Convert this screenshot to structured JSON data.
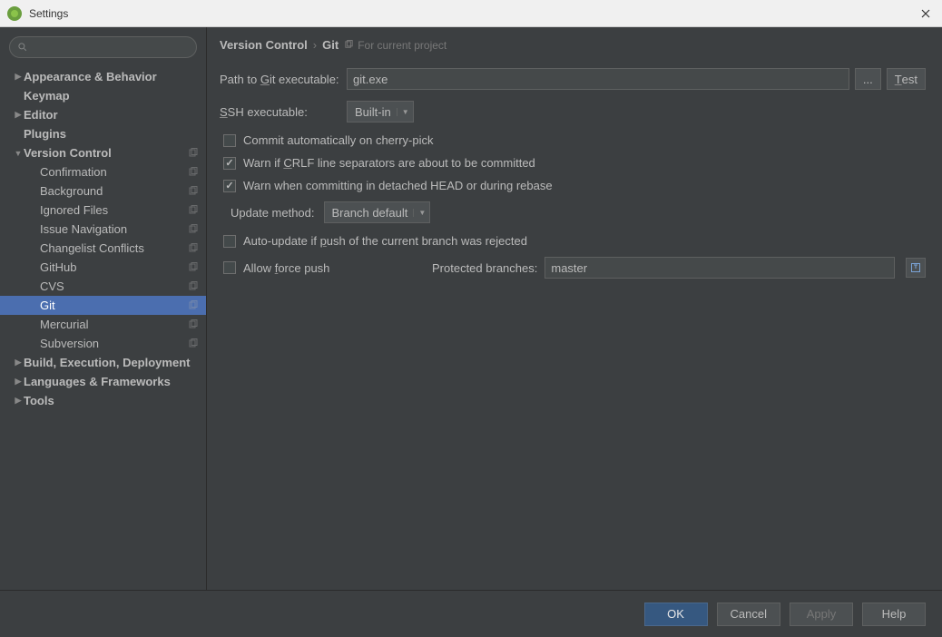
{
  "titlebar": {
    "title": "Settings"
  },
  "breadcrumb": {
    "root": "Version Control",
    "sep": "›",
    "leaf": "Git",
    "note": "For current project"
  },
  "sidebar": {
    "items": [
      {
        "label": "Appearance & Behavior",
        "level": 0,
        "arrow": "▶",
        "bold": true
      },
      {
        "label": "Keymap",
        "level": 0,
        "arrow": "",
        "bold": true
      },
      {
        "label": "Editor",
        "level": 0,
        "arrow": "▶",
        "bold": true
      },
      {
        "label": "Plugins",
        "level": 0,
        "arrow": "",
        "bold": true
      },
      {
        "label": "Version Control",
        "level": 0,
        "arrow": "▼",
        "bold": true,
        "badge": true
      },
      {
        "label": "Confirmation",
        "level": 1,
        "arrow": "",
        "badge": true
      },
      {
        "label": "Background",
        "level": 1,
        "arrow": "",
        "badge": true
      },
      {
        "label": "Ignored Files",
        "level": 1,
        "arrow": "",
        "badge": true
      },
      {
        "label": "Issue Navigation",
        "level": 1,
        "arrow": "",
        "badge": true
      },
      {
        "label": "Changelist Conflicts",
        "level": 1,
        "arrow": "",
        "badge": true
      },
      {
        "label": "GitHub",
        "level": 1,
        "arrow": "",
        "badge": true
      },
      {
        "label": "CVS",
        "level": 1,
        "arrow": "",
        "badge": true
      },
      {
        "label": "Git",
        "level": 1,
        "arrow": "",
        "badge": true,
        "selected": true
      },
      {
        "label": "Mercurial",
        "level": 1,
        "arrow": "",
        "badge": true
      },
      {
        "label": "Subversion",
        "level": 1,
        "arrow": "",
        "badge": true
      },
      {
        "label": "Build, Execution, Deployment",
        "level": 0,
        "arrow": "▶",
        "bold": true
      },
      {
        "label": "Languages & Frameworks",
        "level": 0,
        "arrow": "▶",
        "bold": true
      },
      {
        "label": "Tools",
        "level": 0,
        "arrow": "▶",
        "bold": true
      }
    ]
  },
  "form": {
    "path_label_pre": "Path to ",
    "path_label_u": "G",
    "path_label_post": "it executable:",
    "path_value": "git.exe",
    "browse": "...",
    "test_u": "T",
    "test_post": "est",
    "ssh_label_u": "S",
    "ssh_label_post": "SH executable:",
    "ssh_value": "Built-in",
    "cb_commit": "Commit automatically on cherry-pick",
    "cb_crlf_pre": "Warn if ",
    "cb_crlf_u": "C",
    "cb_crlf_post": "RLF line separators are about to be committed",
    "cb_detached": "Warn when committing in detached HEAD or during rebase",
    "update_label": "Update method:",
    "update_value": "Branch default",
    "cb_autoupdate_pre": "Auto-update if ",
    "cb_autoupdate_u": "p",
    "cb_autoupdate_post": "ush of the current branch was rejected",
    "cb_force_pre": "Allow ",
    "cb_force_u": "f",
    "cb_force_post": "orce push",
    "protected_label": "Protected branches:",
    "protected_value": "master"
  },
  "footer": {
    "ok": "OK",
    "cancel": "Cancel",
    "apply": "Apply",
    "help": "Help"
  }
}
